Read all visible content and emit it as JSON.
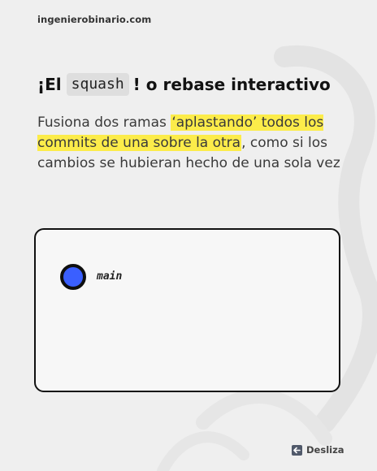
{
  "header": {
    "site_url": "ingenierobinario.com"
  },
  "title": {
    "prefix": "¡El",
    "code": "squash",
    "suffix": "! o rebase interactivo"
  },
  "subtitle": {
    "text_before": "Fusiona dos ramas ",
    "highlight": "‘aplastando’ todos los commits de una sobre la otra",
    "text_after": ", como si los cambios se hubieran hecho de una sola vez"
  },
  "diagram": {
    "branch_label": "main",
    "commit_color": "#3a5fff"
  },
  "footer": {
    "swipe_label": "Desliza",
    "swipe_icon": "arrow-left-icon"
  },
  "colors": {
    "highlight": "#fcec4a",
    "background": "#efefef"
  }
}
